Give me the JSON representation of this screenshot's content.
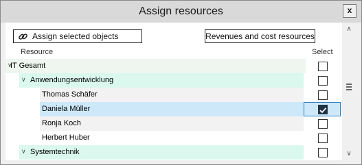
{
  "dialog": {
    "title": "Assign resources",
    "close_glyph": "x"
  },
  "toolbar": {
    "assign_label": "Assign selected objects",
    "revenues_label": "Revenues and cost resources"
  },
  "table": {
    "headers": {
      "resource": "Resource",
      "select": "Select"
    },
    "rows": [
      {
        "label": "IT Gesamt",
        "level": 0,
        "expandable": true,
        "checked": false
      },
      {
        "label": "Anwendungsentwicklung",
        "level": 1,
        "expandable": true,
        "checked": false
      },
      {
        "label": "Thomas Schäfer",
        "level": 2,
        "expandable": false,
        "checked": false
      },
      {
        "label": "Daniela Müller",
        "level": 2,
        "expandable": false,
        "checked": true,
        "selected": true
      },
      {
        "label": "Ronja Koch",
        "level": 2,
        "expandable": false,
        "checked": false
      },
      {
        "label": "Herbert Huber",
        "level": 2,
        "expandable": false,
        "checked": false
      },
      {
        "label": "Systemtechnik",
        "level": 1,
        "expandable": true,
        "checked": false
      }
    ]
  },
  "colors": {
    "level0_bg": "#eef6ef",
    "level1_bg": "#daf8ee",
    "selected_bg": "#cde9f9",
    "checkbox_checked": "#1f3347"
  }
}
